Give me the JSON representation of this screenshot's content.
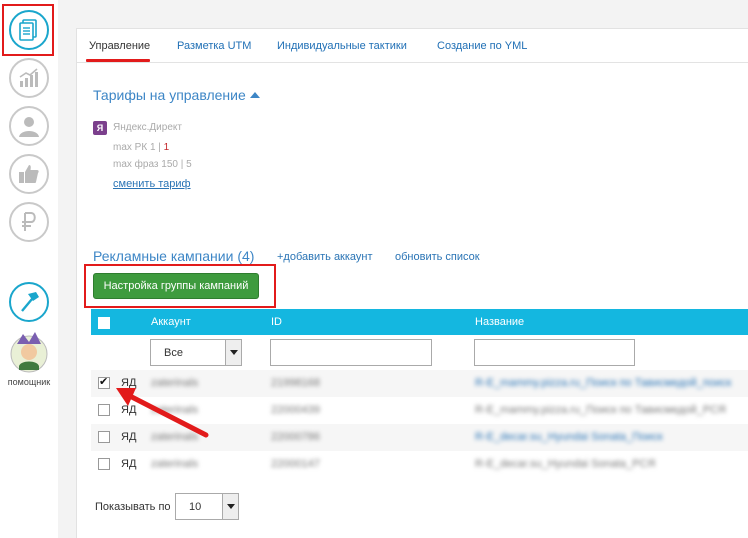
{
  "rail": {
    "items": [
      {
        "icon": "documents-icon"
      },
      {
        "icon": "chart-growth-icon"
      },
      {
        "icon": "user-icon"
      },
      {
        "icon": "thumbs-up-icon"
      },
      {
        "icon": "ruble-icon"
      },
      {
        "icon": "hammer-icon"
      }
    ],
    "helper_label": "помощник"
  },
  "tabs": [
    {
      "label": "Управление",
      "active": true
    },
    {
      "label": "Разметка UTM"
    },
    {
      "label": "Индивидуальные тактики"
    },
    {
      "label": "Создание по YML"
    }
  ],
  "tariffs": {
    "title": "Тарифы на управление",
    "provider_logo": "Я",
    "provider": "Яндекс.Директ",
    "max_rk_label": "max РК 1 | ",
    "max_rk_value": "1",
    "max_phrases": "max фраз 150 | 5",
    "change_link": "сменить тариф"
  },
  "campaigns": {
    "title": "Рекламные кампании (4)",
    "add_account": "+добавить аккаунт",
    "refresh": "обновить список",
    "group_settings_button": "Настройка группы кампаний"
  },
  "table": {
    "headers": {
      "account": "Аккаунт",
      "id": "ID",
      "name": "Название"
    },
    "account_filter": "Все",
    "rows": [
      {
        "checked": true,
        "type": "ЯД",
        "account": "zaterinals",
        "id": "21998168",
        "name": "R-E_mammy.pizza.ru_Поиск по Тависмедой_поиск",
        "name_link": true
      },
      {
        "checked": false,
        "type": "ЯД",
        "account": "zaterinals",
        "id": "22000439",
        "name": "R-E_mammy.pizza.ru_Поиск по Тависмедой_РСЯ",
        "name_link": false
      },
      {
        "checked": false,
        "type": "ЯД",
        "account": "zaterinals",
        "id": "22000786",
        "name": "R-E_decar.su_Hyundai Sonata_Поиск",
        "name_link": true
      },
      {
        "checked": false,
        "type": "ЯД",
        "account": "zaterinals",
        "id": "22000147",
        "name": "R-E_decar.su_Hyundai Sonata_РСЯ",
        "name_link": false
      }
    ]
  },
  "pager": {
    "label": "Показывать по",
    "value": "10"
  },
  "colors": {
    "accent": "#14b7e0",
    "highlight": "#e21b1b",
    "button": "#3e9b3e",
    "link": "#2a74b5"
  }
}
